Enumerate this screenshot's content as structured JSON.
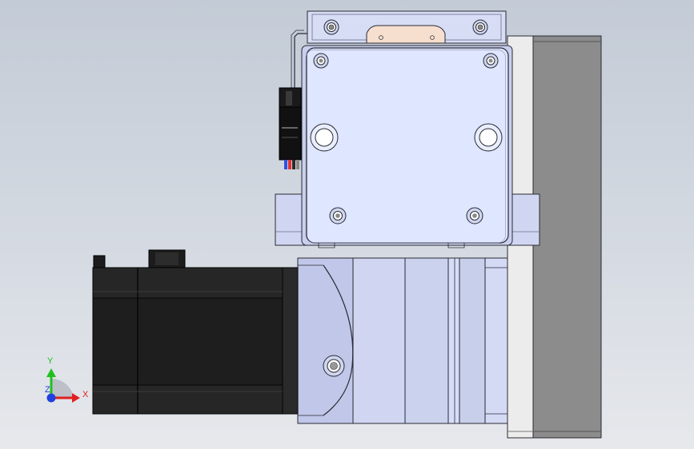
{
  "triad": {
    "x_label": "X",
    "y_label": "Y",
    "z_label": "Z",
    "x_color": "#e02020",
    "y_color": "#20c020",
    "z_color": "#2040e0"
  },
  "colors": {
    "part_light": "#d6ddf5",
    "part_mid": "#c4cbeb",
    "part_dark": "#aab2d8",
    "motor_body": "#1e1e1e",
    "rail_gray": "#8c8c8c",
    "rail_edge": "#eaeaea",
    "outline": "#2a2a33",
    "background_top": "#c3cbd6",
    "background_bottom": "#e6e8ec"
  }
}
